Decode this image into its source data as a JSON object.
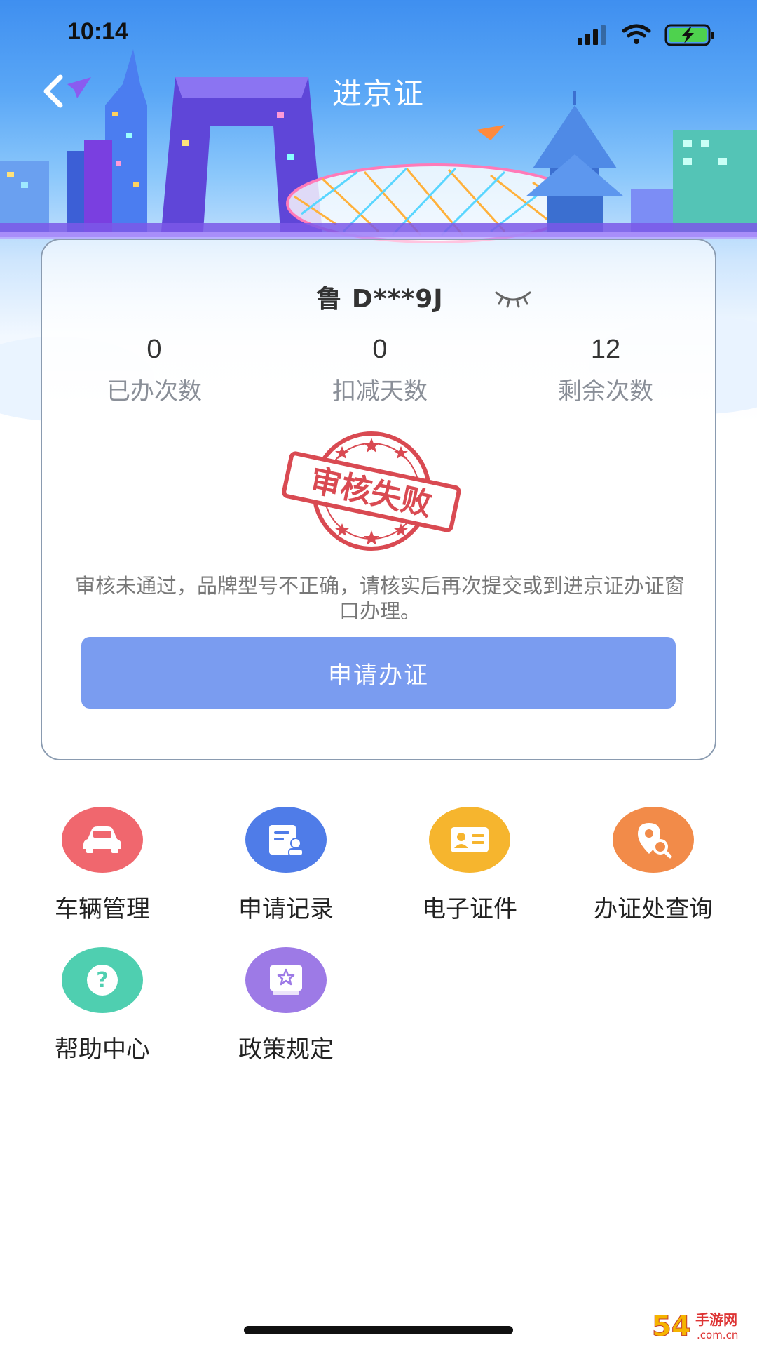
{
  "status_bar": {
    "time": "10:14"
  },
  "nav": {
    "title": "进京证",
    "back_icon": "back-arrow-icon"
  },
  "card": {
    "plate": "鲁 D***9J",
    "eye_icon": "eye-closed-icon",
    "stats": [
      {
        "value": "0",
        "label": "已办次数"
      },
      {
        "value": "0",
        "label": "扣减天数"
      },
      {
        "value": "12",
        "label": "剩余次数"
      }
    ],
    "stamp_text": "审核失败",
    "message": "审核未通过，品牌型号不正确，请核实后再次提交或到进京证办证窗口办理。",
    "apply_button": "申请办证"
  },
  "menu": [
    {
      "label": "车辆管理",
      "icon": "car-icon",
      "color": "#f0676e"
    },
    {
      "label": "申请记录",
      "icon": "document-user-icon",
      "color": "#4f7ce8"
    },
    {
      "label": "电子证件",
      "icon": "id-card-icon",
      "color": "#f6b52e"
    },
    {
      "label": "办证处查询",
      "icon": "location-search-icon",
      "color": "#f28b49"
    },
    {
      "label": "帮助中心",
      "icon": "question-icon",
      "color": "#4fcfb0"
    },
    {
      "label": "政策规定",
      "icon": "policy-book-icon",
      "color": "#9d7ae6"
    }
  ],
  "watermark": {
    "text": "手游网",
    "domain": ".com.cn"
  },
  "colors": {
    "accent": "#7a9cf0",
    "stamp": "#d94a52",
    "card_border": "#8a9bb0"
  }
}
